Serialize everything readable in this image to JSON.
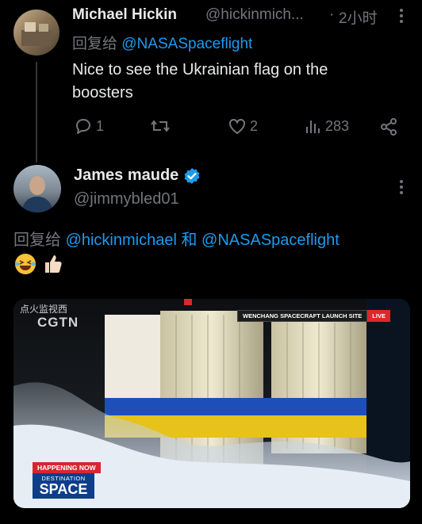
{
  "tweet1": {
    "author_name": "Michael Hickin",
    "handle": "@hickinmich...",
    "dot": "·",
    "time": "2小时",
    "reply_prefix": "回复给",
    "reply_to": "@NASASpaceflight",
    "text_line1": "Nice to see the Ukrainian flag on the",
    "text_line2": "boosters",
    "replies": "1",
    "likes": "2",
    "views": "283"
  },
  "tweet2": {
    "author_name": "James maude",
    "handle": "@jimmybled01",
    "reply_prefix": "回复给",
    "reply_to_1": "@hickinmichael",
    "conjunction": "和",
    "reply_to_2": "@NASASpaceflight",
    "emoji": "😂👍🏻",
    "video": {
      "watermark_cn": "点火监视西",
      "watermark_logo": "CGTN",
      "banner_title": "WENCHANG SPACECRAFT LAUNCH SITE",
      "live_badge": "LIVE",
      "happening_now": "HAPPENING NOW",
      "destination": "DESTINATION",
      "space": "SPACE"
    }
  },
  "colors": {
    "background": "#000000",
    "text": "#e7e9ea",
    "muted": "#71767b",
    "link": "#1d9bf0",
    "verified": "#1d9bf0",
    "live": "#e0252b"
  },
  "icons": [
    "more-icon",
    "reply-icon",
    "retweet-icon",
    "like-icon",
    "views-icon",
    "share-icon",
    "verified-badge-icon"
  ]
}
